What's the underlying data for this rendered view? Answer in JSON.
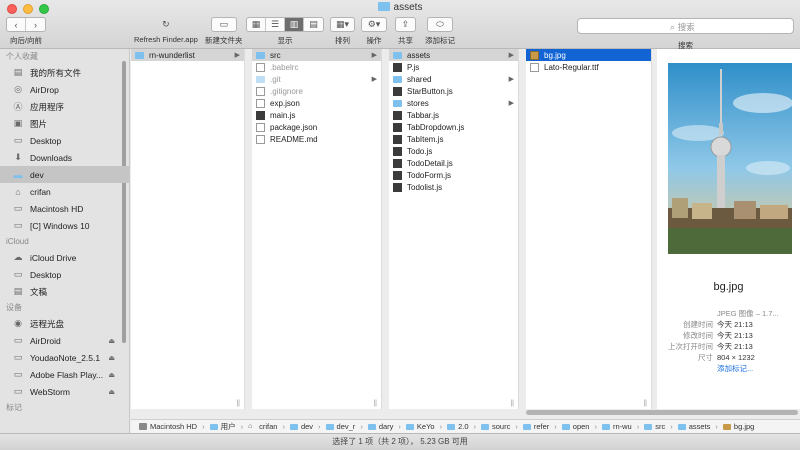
{
  "window": {
    "title": "assets"
  },
  "toolbar": {
    "nav_label": "向后/向前",
    "refresh_label": "Refresh Finder.app",
    "new_folder_label": "新建文件夹",
    "view_label": "显示",
    "arrange_label": "排列",
    "action_label": "操作",
    "share_label": "共享",
    "tags_label": "添加标记",
    "search_label": "搜索",
    "search_placeholder": "搜索"
  },
  "sidebar": {
    "sections": [
      {
        "title": "个人收藏",
        "items": [
          {
            "label": "我的所有文件",
            "icon": "all-files-icon"
          },
          {
            "label": "AirDrop",
            "icon": "airdrop-icon"
          },
          {
            "label": "应用程序",
            "icon": "applications-icon"
          },
          {
            "label": "图片",
            "icon": "pictures-icon"
          },
          {
            "label": "Desktop",
            "icon": "desktop-icon"
          },
          {
            "label": "Downloads",
            "icon": "downloads-icon"
          },
          {
            "label": "dev",
            "icon": "folder-icon",
            "selected": true
          },
          {
            "label": "crifan",
            "icon": "home-icon"
          },
          {
            "label": "Macintosh HD",
            "icon": "hard-drive-icon"
          },
          {
            "label": "[C] Windows 10",
            "icon": "hard-drive-icon"
          }
        ]
      },
      {
        "title": "iCloud",
        "items": [
          {
            "label": "iCloud Drive",
            "icon": "icloud-icon"
          },
          {
            "label": "Desktop",
            "icon": "desktop-icon"
          },
          {
            "label": "文稿",
            "icon": "documents-icon"
          }
        ]
      },
      {
        "title": "设备",
        "items": [
          {
            "label": "远程光盘",
            "icon": "optical-disc-icon"
          },
          {
            "label": "AirDroid",
            "icon": "drive-icon",
            "eject": true
          },
          {
            "label": "YoudaoNote_2.5.1",
            "icon": "drive-icon",
            "eject": true
          },
          {
            "label": "Adobe Flash Play...",
            "icon": "drive-icon",
            "eject": true
          },
          {
            "label": "WebStorm",
            "icon": "drive-icon",
            "eject": true
          }
        ]
      },
      {
        "title": "标记",
        "items": []
      }
    ]
  },
  "columns": [
    {
      "items": [
        {
          "name": "rn-wunderlist",
          "kind": "folder",
          "arrow": true,
          "state": "sel"
        }
      ]
    },
    {
      "items": [
        {
          "name": "src",
          "kind": "folder",
          "arrow": true,
          "state": "sel"
        },
        {
          "name": ".babelrc",
          "kind": "file",
          "dim": true
        },
        {
          "name": ".git",
          "kind": "folder",
          "arrow": true,
          "dim": true
        },
        {
          "name": ".gitignore",
          "kind": "file",
          "dim": true
        },
        {
          "name": "exp.json",
          "kind": "file"
        },
        {
          "name": "main.js",
          "kind": "jsfile"
        },
        {
          "name": "package.json",
          "kind": "file"
        },
        {
          "name": "README.md",
          "kind": "file"
        }
      ]
    },
    {
      "items": [
        {
          "name": "assets",
          "kind": "folder",
          "arrow": true,
          "state": "sel"
        },
        {
          "name": "P.js",
          "kind": "jsfile"
        },
        {
          "name": "shared",
          "kind": "folder",
          "arrow": true
        },
        {
          "name": "StarButton.js",
          "kind": "jsfile"
        },
        {
          "name": "stores",
          "kind": "folder",
          "arrow": true
        },
        {
          "name": "Tabbar.js",
          "kind": "jsfile"
        },
        {
          "name": "TabDropdown.js",
          "kind": "jsfile"
        },
        {
          "name": "TabItem.js",
          "kind": "jsfile"
        },
        {
          "name": "Todo.js",
          "kind": "jsfile"
        },
        {
          "name": "TodoDetail.js",
          "kind": "jsfile"
        },
        {
          "name": "TodoForm.js",
          "kind": "jsfile"
        },
        {
          "name": "Todolist.js",
          "kind": "jsfile"
        }
      ]
    },
    {
      "items": [
        {
          "name": "bg.jpg",
          "kind": "img",
          "state": "hl"
        },
        {
          "name": "Lato-Regular.ttf",
          "kind": "file"
        }
      ]
    }
  ],
  "preview": {
    "name": "bg.jpg",
    "kind": "JPEG 图像 – 1.7...",
    "meta": [
      {
        "k": "创建时间",
        "v": "今天 21:13"
      },
      {
        "k": "修改时间",
        "v": "今天 21:13"
      },
      {
        "k": "上次打开时间",
        "v": "今天 21:13"
      },
      {
        "k": "尺寸",
        "v": "804 × 1232"
      }
    ],
    "add_tags": "添加标记..."
  },
  "pathbar": [
    {
      "label": "Macintosh HD",
      "icon": "hd"
    },
    {
      "label": "用户",
      "icon": "folder"
    },
    {
      "label": "crifan",
      "icon": "home"
    },
    {
      "label": "dev",
      "icon": "folder"
    },
    {
      "label": "dev_r",
      "icon": "folder"
    },
    {
      "label": "dary",
      "icon": "folder"
    },
    {
      "label": "KeYo",
      "icon": "folder"
    },
    {
      "label": "2.0",
      "icon": "folder"
    },
    {
      "label": "sourc",
      "icon": "folder"
    },
    {
      "label": "refer",
      "icon": "folder"
    },
    {
      "label": "open",
      "icon": "folder"
    },
    {
      "label": "rn-wu",
      "icon": "folder"
    },
    {
      "label": "src",
      "icon": "folder"
    },
    {
      "label": "assets",
      "icon": "folder"
    },
    {
      "label": "bg.jpg",
      "icon": "img"
    }
  ],
  "status": {
    "text": "选择了 1 项（共 2 项）， 5.23 GB 可用"
  },
  "colors": {
    "selection": "#1264d5",
    "folder": "#7ec0ee"
  }
}
